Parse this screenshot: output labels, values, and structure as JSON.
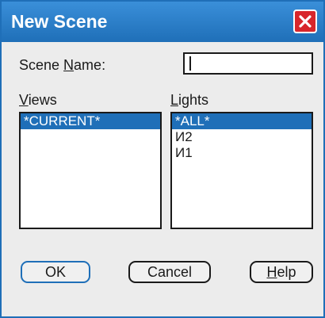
{
  "window": {
    "title": "New Scene"
  },
  "scene_name": {
    "label_prefix": "Scene ",
    "label_hotkey": "N",
    "label_rest": "ame:",
    "value": ""
  },
  "views": {
    "label_hotkey": "V",
    "label_rest": "iews",
    "items": [
      "*CURRENT*"
    ],
    "selected_index": 0
  },
  "lights": {
    "label_hotkey": "L",
    "label_rest": "ights",
    "items": [
      "*ALL*",
      "И2",
      "И1"
    ],
    "selected_index": 0
  },
  "buttons": {
    "ok": "OK",
    "cancel": "Cancel",
    "help_hotkey": "H",
    "help_rest": "elp"
  },
  "colors": {
    "accent": "#1f6fb8",
    "close": "#d8262c",
    "background": "#ececec"
  },
  "icons": {
    "close": "close-icon"
  }
}
